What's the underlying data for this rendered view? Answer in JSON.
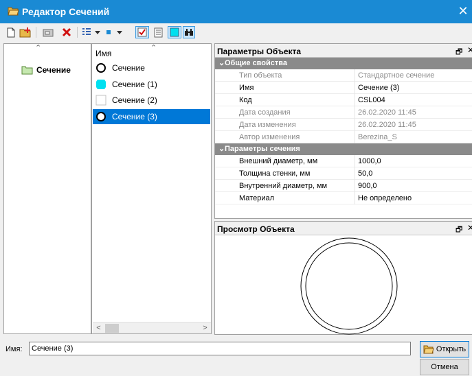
{
  "window": {
    "title": "Редактор Сечений",
    "close": "✕"
  },
  "toolbar": {
    "icons": [
      "new-document-icon",
      "open-folder-icon",
      "library-icon",
      "delete-icon",
      "list-view-icon",
      "dropdown-icon",
      "small-square-icon",
      "dropdown-icon",
      "checkbox-icon",
      "text-list-icon",
      "cyan-square-icon",
      "binoculars-icon"
    ]
  },
  "tree": {
    "items": [
      {
        "label": "Сечение"
      }
    ]
  },
  "list": {
    "header": "Имя",
    "items": [
      {
        "label": "Сечение",
        "icon": "ring-icon",
        "selected": false
      },
      {
        "label": "Сечение (1)",
        "icon": "cyan-section-icon",
        "selected": false
      },
      {
        "label": "Сечение (2)",
        "icon": "empty-section-icon",
        "selected": false
      },
      {
        "label": "Сечение (3)",
        "icon": "ring-icon",
        "selected": true
      }
    ]
  },
  "properties": {
    "title": "Параметры Объекта",
    "pin": "🗗",
    "close": "✕",
    "categories": [
      {
        "name": "Общие свойства",
        "rows": [
          {
            "name": "Тип объекта",
            "value": "Стандартное сечение",
            "readonly": true
          },
          {
            "name": "Имя",
            "value": "Сечение (3)",
            "readonly": false
          },
          {
            "name": "Код",
            "value": "CSL004",
            "readonly": false
          },
          {
            "name": "Дата создания",
            "value": "26.02.2020 11:45",
            "readonly": true
          },
          {
            "name": "Дата изменения",
            "value": "26.02.2020 11:45",
            "readonly": true
          },
          {
            "name": "Автор изменения",
            "value": "Berezina_S",
            "readonly": true
          }
        ]
      },
      {
        "name": "Параметры сечения",
        "rows": [
          {
            "name": "Внешний диаметр, мм",
            "value": "1000,0",
            "readonly": false
          },
          {
            "name": "Толщина стенки, мм",
            "value": "50,0",
            "readonly": false
          },
          {
            "name": "Внутренний диаметр, мм",
            "value": "900,0",
            "readonly": false
          },
          {
            "name": "Материал",
            "value": "Не определено",
            "readonly": false
          }
        ]
      }
    ]
  },
  "preview": {
    "title": "Просмотр Объекта",
    "pin": "🗗",
    "close": "✕"
  },
  "footer": {
    "name_label": "Имя:",
    "name_value": "Сечение (3)",
    "open_label": "Открыть",
    "cancel_label": "Отмена"
  }
}
